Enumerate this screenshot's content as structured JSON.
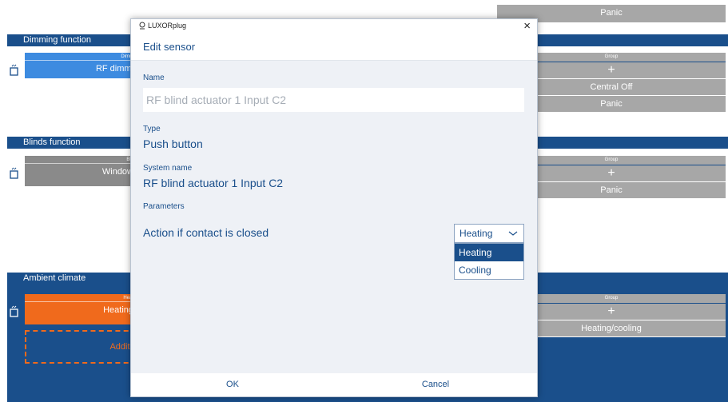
{
  "background": {
    "sections": [
      {
        "label": "Dimming function"
      },
      {
        "label": "Blinds function"
      },
      {
        "label": "Ambient climate"
      }
    ],
    "tiles": {
      "dimming": {
        "top": "Dimm",
        "main": "RF dimmi"
      },
      "blinds": {
        "top": "Blir",
        "main": "Window"
      },
      "heating": {
        "top": "Heat",
        "main": "Heating"
      },
      "additional": "Additi"
    },
    "groups": {
      "top_panic": "Panic",
      "dimming": {
        "header": "Group",
        "plus": "+",
        "items": [
          "Central Off",
          "Panic"
        ]
      },
      "blinds": {
        "header": "Group",
        "plus": "+",
        "items": [
          "Panic"
        ]
      },
      "climate": {
        "header": "Group",
        "plus": "+",
        "items": [
          "Heating/cooling"
        ]
      }
    }
  },
  "dialog": {
    "app_title": "LUXORplug",
    "heading": "Edit sensor",
    "name_label": "Name",
    "name_placeholder": "RF blind actuator 1 Input C2",
    "type_label": "Type",
    "type_value": "Push button",
    "system_name_label": "System name",
    "system_name_value": "RF blind actuator 1 Input C2",
    "parameters_label": "Parameters",
    "action_label": "Action if contact is closed",
    "select_value": "Heating",
    "options": [
      "Heating",
      "Cooling"
    ],
    "ok_label": "OK",
    "cancel_label": "Cancel"
  },
  "colors": {
    "brand_blue": "#1a4f8b",
    "dimming_blue": "#3d8be0",
    "blinds_gray": "#8a8a8a",
    "heating_orange": "#f06a1c",
    "group_gray": "#a7a7a7"
  }
}
